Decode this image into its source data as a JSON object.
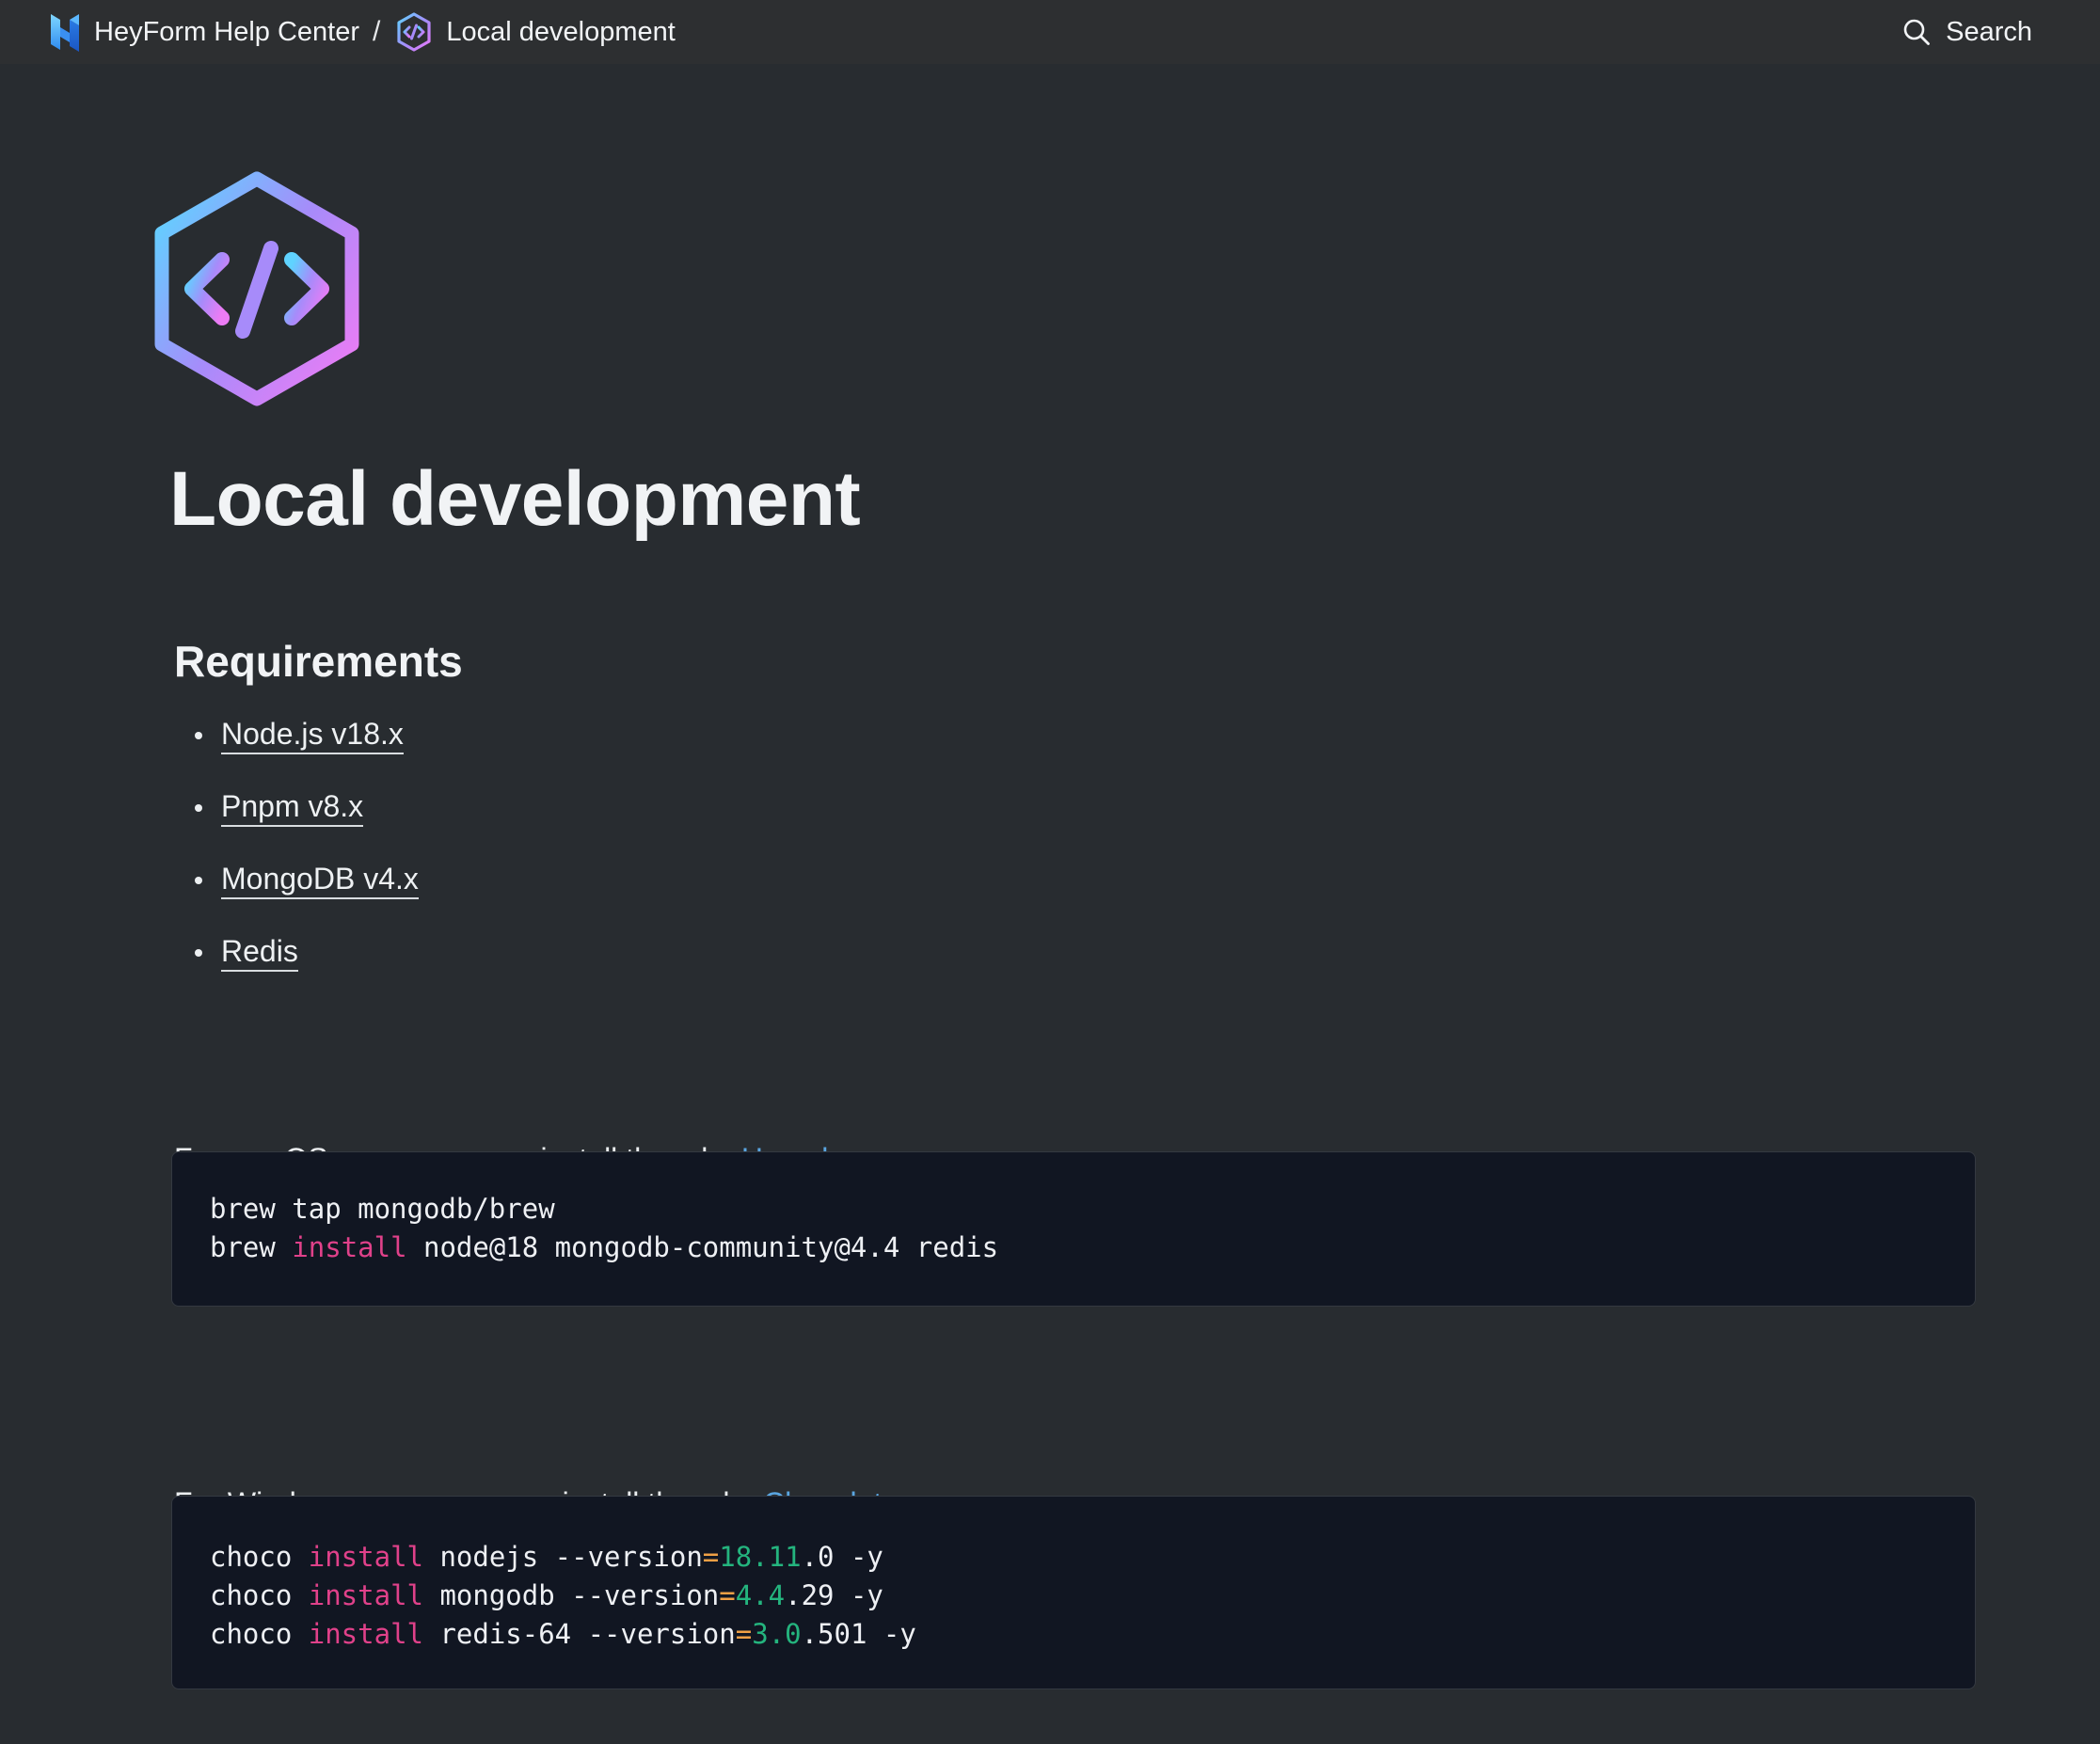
{
  "topbar": {
    "brand_label": "HeyForm Help Center",
    "separator": "/",
    "page_label": "Local development",
    "search_label": "Search"
  },
  "article": {
    "title": "Local development",
    "requirements_heading": "Requirements",
    "requirements": [
      {
        "label": "Node.js v18.x"
      },
      {
        "label": "Pnpm v8.x"
      },
      {
        "label": "MongoDB v4.x"
      },
      {
        "label": "Redis"
      }
    ],
    "mac_text_before": "For macOS users, you can install them by ",
    "mac_link": "Homebrew",
    "mac_text_after": ":",
    "mac_code": [
      [
        {
          "t": "brew tap mongodb/brew",
          "c": ""
        }
      ],
      [
        {
          "t": "brew ",
          "c": ""
        },
        {
          "t": "install",
          "c": "kw"
        },
        {
          "t": " node@18 mongodb-community@4.4 redis",
          "c": ""
        }
      ]
    ],
    "win_text_before": "For Windows users, you can install them by ",
    "win_link": "Chocolatey",
    "win_text_after": ":",
    "win_code": [
      [
        {
          "t": "choco ",
          "c": ""
        },
        {
          "t": "install",
          "c": "kw"
        },
        {
          "t": " nodejs --version",
          "c": ""
        },
        {
          "t": "=",
          "c": "op"
        },
        {
          "t": "18.11",
          "c": "num"
        },
        {
          "t": ".0 -y",
          "c": ""
        }
      ],
      [
        {
          "t": "choco ",
          "c": ""
        },
        {
          "t": "install",
          "c": "kw"
        },
        {
          "t": " mongodb --version",
          "c": ""
        },
        {
          "t": "=",
          "c": "op"
        },
        {
          "t": "4.4",
          "c": "num"
        },
        {
          "t": ".29 -y",
          "c": ""
        }
      ],
      [
        {
          "t": "choco ",
          "c": ""
        },
        {
          "t": "install",
          "c": "kw"
        },
        {
          "t": " redis-64 --version",
          "c": ""
        },
        {
          "t": "=",
          "c": "op"
        },
        {
          "t": "3.0",
          "c": "num"
        },
        {
          "t": ".501 -y",
          "c": ""
        }
      ]
    ]
  },
  "icons": {
    "brand": "heyform-logo-icon",
    "page": "code-hexagon-icon",
    "search": "search-icon"
  },
  "colors": {
    "background": "#282c30",
    "topbar": "#2d2f31",
    "code_bg": "#111622",
    "link": "#5aa6e2",
    "keyword": "#e0418a",
    "operator": "#f0a045",
    "number": "#24b47e",
    "gradient_start": "#5fd3ff",
    "gradient_mid": "#a78bfa",
    "gradient_end": "#e879f9"
  }
}
